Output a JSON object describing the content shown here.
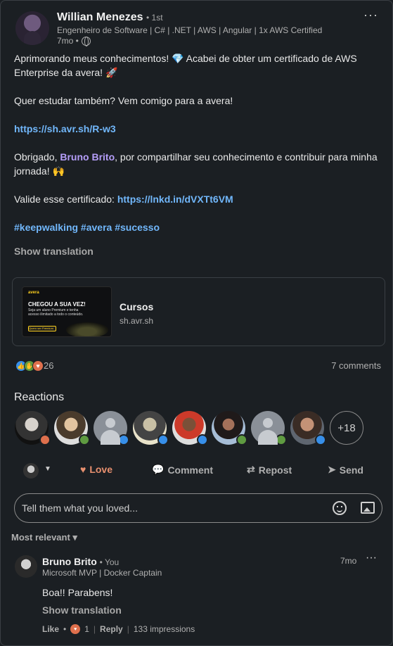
{
  "post": {
    "author": "Willian Menezes",
    "degree": "• 1st",
    "headline": "Engenheiro de Software | C# | .NET | AWS | Angular | 1x AWS Certified",
    "time": "7mo •",
    "more": "···",
    "body": {
      "p1a": "Aprimorando meus conhecimentos! ",
      "p1_emoji": "💎",
      "p1b": " Acabei de obter um certificado de AWS Enterprise da avera! ",
      "p1_emoji2": "🚀",
      "p2": "Quer estudar também? Vem comigo para a avera!",
      "p3_link": "https://sh.avr.sh/R-w3",
      "p4a": "Obrigado, ",
      "p4_mention": "Bruno Brito",
      "p4b": ", por compartilhar seu conhecimento e contribuir para minha jornada! ",
      "p4_emoji": "🙌",
      "p5_label": "Valide esse certificado: ",
      "p5_link": "https://lnkd.in/dVXTt6VM",
      "hashtags": "#keepwalking #avera #sucesso"
    },
    "show_translation": "Show translation"
  },
  "card": {
    "thumb_brand": "avera",
    "thumb_title": "CHEGOU A SUA VEZ!",
    "thumb_sub": "Seja um aluno Premium e tenha acesso ilimitado a todo o conteúdo.",
    "thumb_btn": "Quero ser Premium",
    "title": "Cursos",
    "url": "sh.avr.sh"
  },
  "social": {
    "reaction_count": "26",
    "comments": "7 comments"
  },
  "reactions": {
    "title": "Reactions",
    "more": "+18",
    "badges": [
      "love",
      "support",
      "like",
      "like",
      "like",
      "support",
      "support",
      "like"
    ]
  },
  "actions": {
    "love": "Love",
    "comment": "Comment",
    "repost": "Repost",
    "send": "Send"
  },
  "comment_box": {
    "placeholder": "Tell them what you loved..."
  },
  "sort": "Most relevant ▾",
  "comment": {
    "name": "Bruno Brito",
    "you": "• You",
    "headline": "Microsoft MVP | Docker Captain",
    "time": "7mo",
    "more": "···",
    "text": "Boa!! Parabens!",
    "show_translation": "Show translation",
    "like": "Like",
    "love_count": "1",
    "reply": "Reply",
    "impressions": "133 impressions"
  },
  "colors": {
    "background": "#1b1f23",
    "link": "#71b7fb",
    "mention": "#b59ef9",
    "like": "#378fe9",
    "support": "#5f9b41",
    "love": "#df704d"
  }
}
